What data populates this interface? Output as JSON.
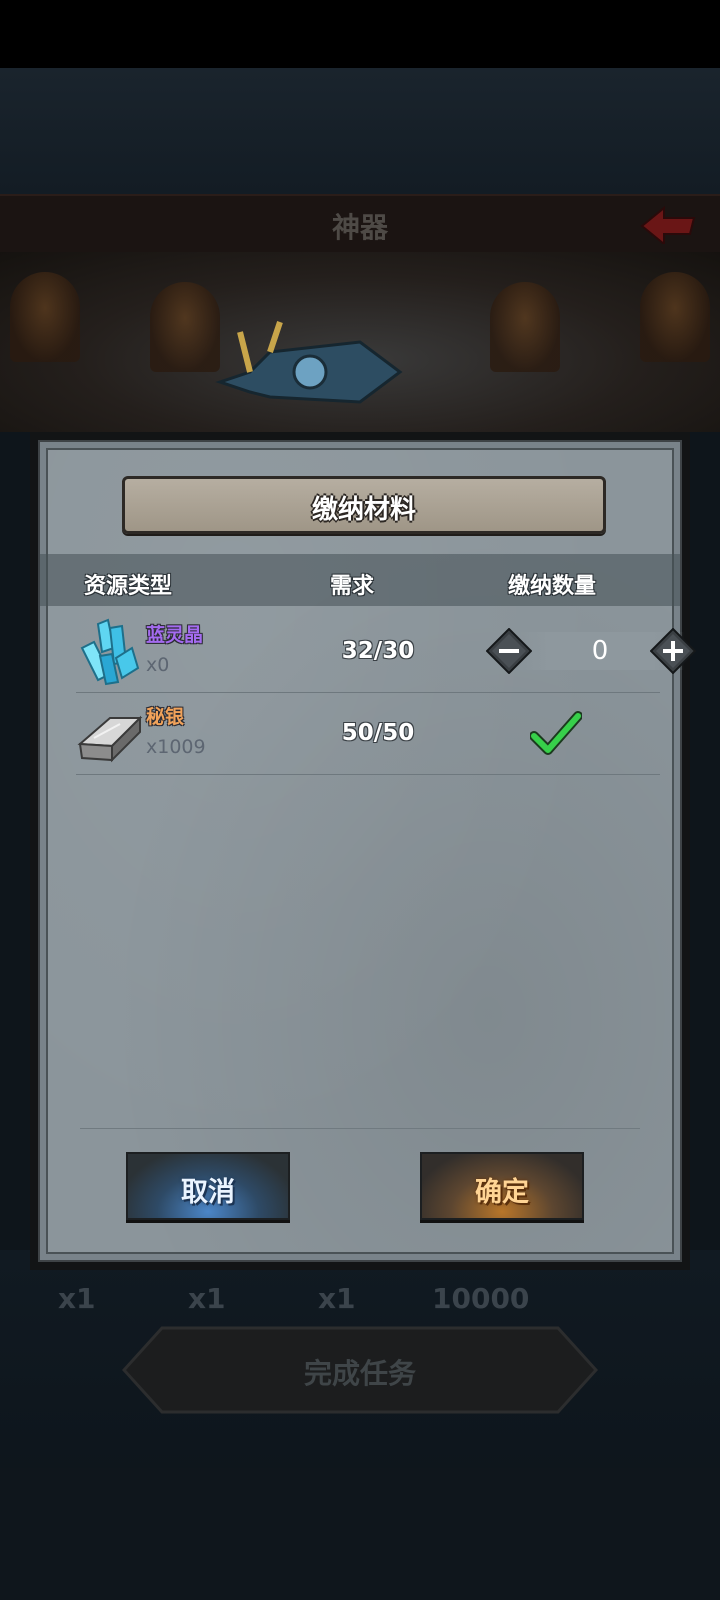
{
  "background": {
    "screen_title": "神器",
    "reward_counts": [
      "x1",
      "x1",
      "x1",
      "10000"
    ],
    "task_button_label": "完成任务"
  },
  "dialog": {
    "title": "缴纳材料",
    "columns": {
      "type": "资源类型",
      "requirement": "需求",
      "submit_quantity": "缴纳数量"
    },
    "items": [
      {
        "name": "蓝灵晶",
        "name_color": "#a46bf0",
        "owned": "x0",
        "requirement": "32/30",
        "submit_value": "0",
        "icon": "blue-crystal-icon"
      },
      {
        "name": "秘银",
        "name_color": "#f0a25a",
        "owned": "x1009",
        "requirement": "50/50",
        "icon": "silver-ingot-icon",
        "status": "complete-checkmark"
      }
    ],
    "cancel_label": "取消",
    "confirm_label": "确定"
  }
}
